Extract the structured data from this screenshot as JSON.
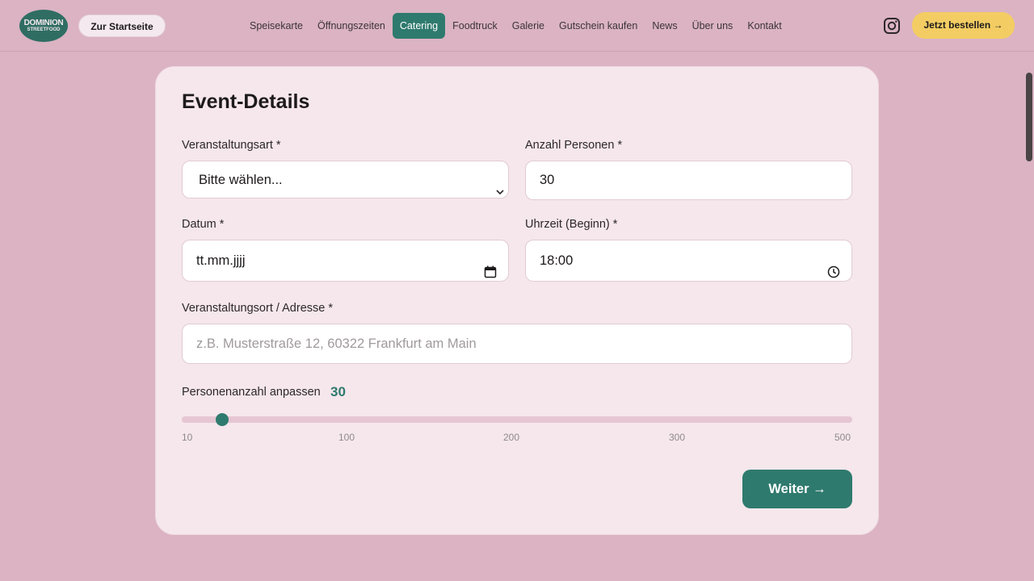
{
  "header": {
    "logo_text_1": "DOMINION",
    "logo_text_2": "STREETFOOD",
    "home_button": "Zur Startseite",
    "nav": [
      {
        "label": "Speisekarte",
        "active": false
      },
      {
        "label": "Öffnungszeiten",
        "active": false
      },
      {
        "label": "Catering",
        "active": true
      },
      {
        "label": "Foodtruck",
        "active": false
      },
      {
        "label": "Galerie",
        "active": false
      },
      {
        "label": "Gutschein kaufen",
        "active": false
      },
      {
        "label": "News",
        "active": false
      },
      {
        "label": "Über uns",
        "active": false
      },
      {
        "label": "Kontakt",
        "active": false
      }
    ],
    "instagram_icon": "instagram-icon",
    "order_button": "Jetzt bestellen →"
  },
  "form": {
    "title": "Event-Details",
    "event_type": {
      "label": "Veranstaltungsart *",
      "value": "Bitte wählen..."
    },
    "persons": {
      "label": "Anzahl Personen *",
      "value": "30"
    },
    "date": {
      "label": "Datum *",
      "value": "tt.mm.jjjj"
    },
    "time": {
      "label": "Uhrzeit (Beginn) *",
      "value": "18:00"
    },
    "location": {
      "label": "Veranstaltungsort / Adresse *",
      "placeholder": "z.B. Musterstraße 12, 60322 Frankfurt am Main"
    },
    "slider": {
      "label": "Personenanzahl anpassen",
      "value": 30,
      "value_text": "30",
      "min": 10,
      "max": 500,
      "ticks": [
        "10",
        "100",
        "200",
        "300",
        "500"
      ]
    },
    "next_button": "Weiter →"
  },
  "colors": {
    "background": "#dbb3c3",
    "accent": "#2f7a6e",
    "order_button": "#f3cd63",
    "card": "#f5e7ec"
  }
}
